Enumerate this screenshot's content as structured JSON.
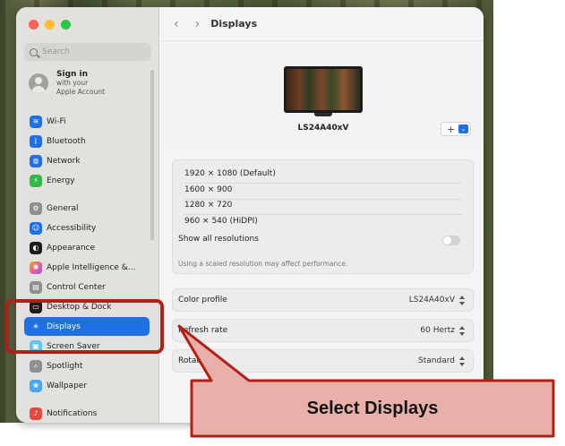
{
  "sidebar": {
    "search_placeholder": "Search",
    "account": {
      "name": "Sign in",
      "line1": "with your",
      "line2": "Apple Account"
    },
    "items": [
      {
        "label": "Wi-Fi",
        "icon": "wifi-icon",
        "color": "#1f6fe5"
      },
      {
        "label": "Bluetooth",
        "icon": "bluetooth-icon",
        "color": "#1f6fe5"
      },
      {
        "label": "Network",
        "icon": "globe-icon",
        "color": "#1f6fe5"
      },
      {
        "label": "Energy",
        "icon": "battery-icon",
        "color": "#34b84a"
      },
      {
        "label": "General",
        "icon": "gear-icon",
        "color": "#8e8e93"
      },
      {
        "label": "Accessibility",
        "icon": "accessibility-icon",
        "color": "#1f6fe5"
      },
      {
        "label": "Appearance",
        "icon": "appearance-icon",
        "color": "#1c1c1e"
      },
      {
        "label": "Apple Intelligence &...",
        "icon": "apple-intelligence-icon",
        "color": "#e8618c"
      },
      {
        "label": "Control Center",
        "icon": "control-center-icon",
        "color": "#8e8e93"
      },
      {
        "label": "Desktop & Dock",
        "icon": "dock-icon",
        "color": "#1c1c1e"
      },
      {
        "label": "Displays",
        "icon": "sun-icon",
        "color": "#1f6fe5"
      },
      {
        "label": "Screen Saver",
        "icon": "screen-saver-icon",
        "color": "#5ac8fa"
      },
      {
        "label": "Spotlight",
        "icon": "magnifier-icon",
        "color": "#8e8e93"
      },
      {
        "label": "Wallpaper",
        "icon": "flower-icon",
        "color": "#4aa6f0"
      },
      {
        "label": "Notifications",
        "icon": "bell-icon",
        "color": "#e5483f"
      }
    ],
    "selected": "Displays"
  },
  "header": {
    "title": "Displays",
    "back": "‹",
    "forward": "›"
  },
  "display": {
    "name": "LS24A40xV",
    "add_label": "+",
    "add_caret": "⌄"
  },
  "resolutions": {
    "options": [
      "1920 × 1080 (Default)",
      "1600 × 900",
      "1280 × 720",
      "960 × 540 (HiDPI)"
    ],
    "show_all_label": "Show all resolutions",
    "show_all_enabled": false,
    "note": "Using a scaled resolution may affect performance."
  },
  "settings": {
    "color_profile": {
      "label": "Color profile",
      "value": "LS24A40xV"
    },
    "refresh_rate": {
      "label": "Refresh rate",
      "value": "60 Hertz"
    },
    "rotation": {
      "label": "Rotation",
      "value": "Standard"
    }
  },
  "annotation": {
    "text": "Select Displays",
    "accent": "#b21f17",
    "fill": "#e9b0aa"
  },
  "icon_glyphs": {
    "wifi": "≋",
    "bluetooth": "ᛒ",
    "globe": "◍",
    "battery": "⚡",
    "gear": "⚙",
    "accessibility": "☺",
    "appearance": "◐",
    "apple_intelligence": "✺",
    "control_center": "▤",
    "dock": "▭",
    "sun": "☀",
    "screen_saver": "▣",
    "magnifier": "⌕",
    "flower": "❀",
    "bell": "♪"
  }
}
